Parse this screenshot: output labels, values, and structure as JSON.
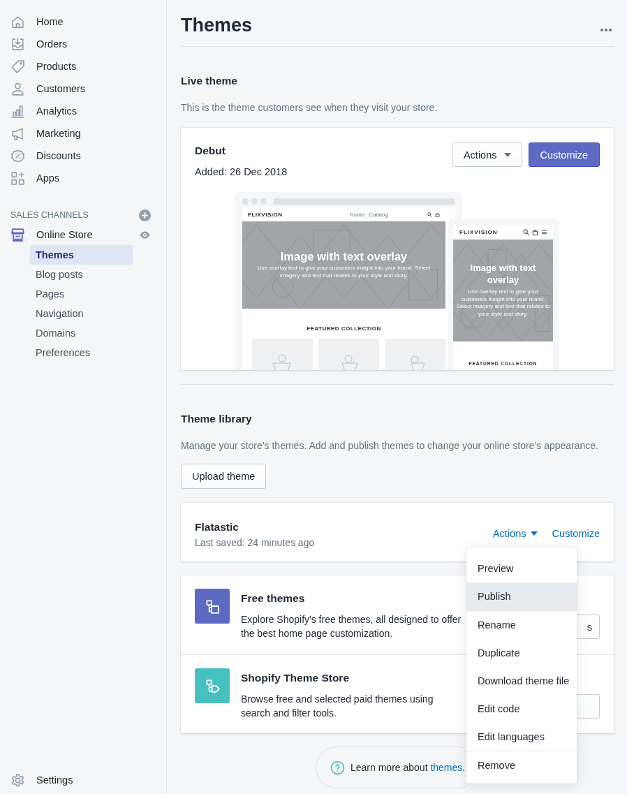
{
  "sidebar": {
    "items": [
      {
        "label": "Home"
      },
      {
        "label": "Orders"
      },
      {
        "label": "Products"
      },
      {
        "label": "Customers"
      },
      {
        "label": "Analytics"
      },
      {
        "label": "Marketing"
      },
      {
        "label": "Discounts"
      },
      {
        "label": "Apps"
      }
    ],
    "sales_channels": {
      "heading": "SALES CHANNELS",
      "channel": "Online Store",
      "children": [
        {
          "label": "Themes",
          "selected": true
        },
        {
          "label": "Blog posts",
          "selected": false
        },
        {
          "label": "Pages",
          "selected": false
        },
        {
          "label": "Navigation",
          "selected": false
        },
        {
          "label": "Domains",
          "selected": false
        },
        {
          "label": "Preferences",
          "selected": false
        }
      ]
    },
    "settings": "Settings"
  },
  "page": {
    "title": "Themes"
  },
  "live_theme": {
    "heading": "Live theme",
    "description": "This is the theme customers see when they visit your store.",
    "theme": {
      "name": "Debut",
      "added": "Added: 26 Dec 2018",
      "actions": "Actions",
      "customize": "Customize",
      "preview": {
        "desktop": {
          "brand": "FLIXVISION",
          "nav": [
            {
              "label": "Home"
            },
            {
              "label": "Catalog"
            }
          ],
          "hero_title": "Image with text overlay",
          "hero_text": "Use overlay text to give your customers insight into your brand. Select imagery and text that relates to your style and story.",
          "featured": "FEATURED COLLECTION"
        },
        "mobile": {
          "brand": "FLIXVISION",
          "hero_title": "Image with text overlay",
          "hero_text": "Use overlay text to give your customers insight into your brand. Select imagery and text that relates to your style and story.",
          "featured": "FEATURED COLLECTION"
        }
      }
    }
  },
  "library": {
    "heading": "Theme library",
    "description": "Manage your store’s themes. Add and publish themes to change your online store’s appearance.",
    "upload": "Upload theme",
    "theme": {
      "name": "Flatastic",
      "saved": "Last saved: 24 minutes ago",
      "actions": "Actions",
      "customize": "Customize"
    },
    "menu": [
      [
        {
          "label": "Preview",
          "selected": false
        },
        {
          "label": "Publish",
          "selected": true
        }
      ],
      [
        {
          "label": "Rename",
          "selected": false
        },
        {
          "label": "Duplicate",
          "selected": false
        },
        {
          "label": "Download theme file",
          "selected": false
        },
        {
          "label": "Edit code",
          "selected": false
        },
        {
          "label": "Edit languages",
          "selected": false
        }
      ],
      [
        {
          "label": "Remove",
          "selected": false
        }
      ]
    ],
    "features": [
      {
        "title": "Free themes",
        "text": "Explore Shopify's free themes, all designed to offer the best home page customization.",
        "button": "s",
        "color": "#5c6ac4"
      },
      {
        "title": "Shopify Theme Store",
        "text": "Browse free and selected paid themes using search and filter tools.",
        "color": "#47c1bf"
      }
    ],
    "help": {
      "text": "Learn more about ",
      "link": "themes",
      "end": "."
    }
  }
}
